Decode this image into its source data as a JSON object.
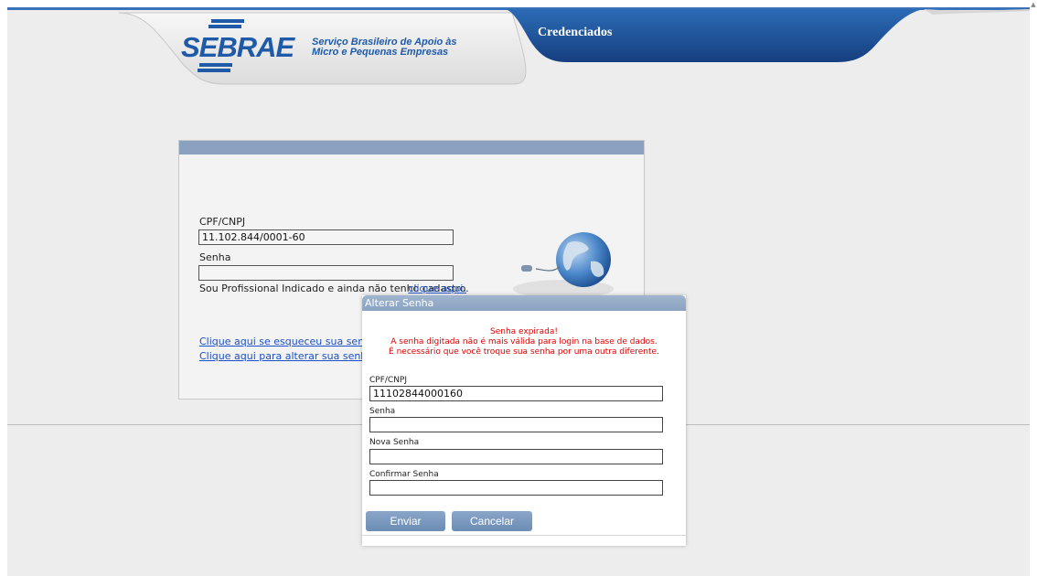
{
  "header": {
    "logo_text": "SEBRAE",
    "tagline": "Serviço Brasileiro de Apoio às Micro e Pequenas Empresas",
    "tab_label": "Credenciados"
  },
  "login": {
    "cpf_label": "CPF/CNPJ",
    "cpf_value": "11.102.844/0001-60",
    "senha_label": "Senha",
    "senha_value": "",
    "cadastro_text": "Sou Profissional Indicado e ainda não tenho cadastro.",
    "cadastro_link": "clique aqui.",
    "forgot_link": "Clique aqui se esqueceu sua senha.",
    "change_link": "Clique aqui para alterar sua senha."
  },
  "modal": {
    "title": "Alterar Senha",
    "error_title": "Senha expirada!",
    "error_line1": "A senha digitada não é mais válida para login na base de dados.",
    "error_line2": "É necessário que você troque sua senha por uma outra diferente.",
    "cpf_label": "CPF/CNPJ",
    "cpf_value": "11102844000160",
    "senha_label": "Senha",
    "senha_value": "",
    "nova_label": "Nova Senha",
    "nova_value": "",
    "confirmar_label": "Confirmar Senha",
    "confirmar_value": "",
    "submit_label": "Enviar",
    "cancel_label": "Cancelar"
  },
  "colors": {
    "brand_blue": "#1f5aa9",
    "header_tab": "#1d4f96",
    "error_red": "#e00000",
    "link_blue": "#1a4fc7",
    "button": "#7997bd"
  },
  "icons": {
    "globe": "globe-with-mouse-icon",
    "scroll_up": "scroll-up-arrow-icon"
  }
}
